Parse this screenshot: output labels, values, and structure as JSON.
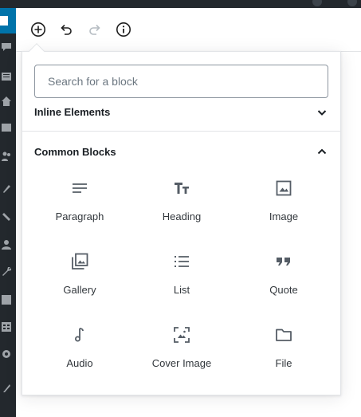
{
  "toolbar": {
    "add_block_icon": "plus-circle-icon",
    "undo_icon": "undo-icon",
    "redo_icon": "redo-icon",
    "info_icon": "info-icon"
  },
  "inserter": {
    "search": {
      "placeholder": "Search for a block",
      "value": ""
    },
    "panels": [
      {
        "title": "Inline Elements",
        "expanded": false,
        "toggle_icon": "chevron-down-icon"
      },
      {
        "title": "Common Blocks",
        "expanded": true,
        "toggle_icon": "chevron-up-icon"
      }
    ],
    "blocks": [
      {
        "label": "Paragraph",
        "icon": "paragraph-icon"
      },
      {
        "label": "Heading",
        "icon": "heading-icon"
      },
      {
        "label": "Image",
        "icon": "image-icon"
      },
      {
        "label": "Gallery",
        "icon": "gallery-icon"
      },
      {
        "label": "List",
        "icon": "list-icon"
      },
      {
        "label": "Quote",
        "icon": "quote-icon"
      },
      {
        "label": "Audio",
        "icon": "audio-icon"
      },
      {
        "label": "Cover Image",
        "icon": "cover-image-icon"
      },
      {
        "label": "File",
        "icon": "file-icon"
      }
    ]
  },
  "colors": {
    "admin_sidebar": "#23282d",
    "admin_active": "#0073aa",
    "icon_gray": "#555d66"
  }
}
